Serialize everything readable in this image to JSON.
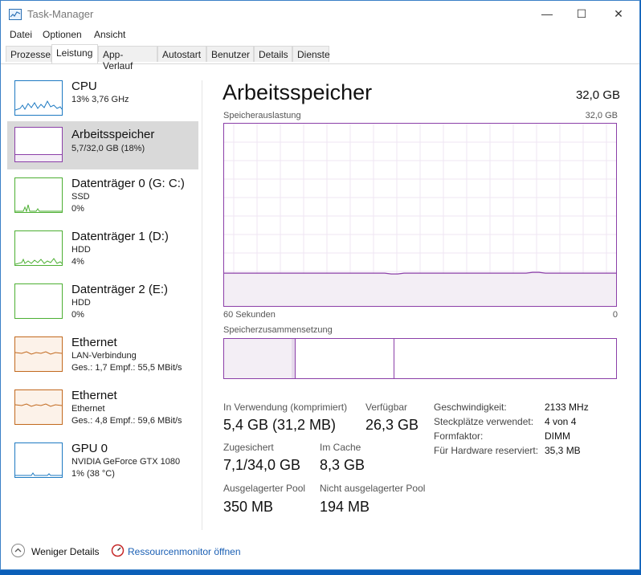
{
  "window": {
    "title": "Task-Manager",
    "minimize": "—",
    "maximize": "☐",
    "close": "✕"
  },
  "menu": [
    "Datei",
    "Optionen",
    "Ansicht"
  ],
  "tabs": [
    "Prozesse",
    "Leistung",
    "App-Verlauf",
    "Autostart",
    "Benutzer",
    "Details",
    "Dienste"
  ],
  "active_tab": "Leistung",
  "sidebar": [
    {
      "title": "CPU",
      "line1": "13% 3,76 GHz",
      "line2": "",
      "line3": "",
      "color": "#1e7ac2"
    },
    {
      "title": "Arbeitsspeicher",
      "line1": "5,7/32,0 GB (18%)",
      "line2": "",
      "line3": "",
      "color": "#8b3fa8"
    },
    {
      "title": "Datenträger 0 (G: C:)",
      "line1": "SSD",
      "line2": "0%",
      "line3": "",
      "color": "#4caf32"
    },
    {
      "title": "Datenträger 1 (D:)",
      "line1": "HDD",
      "line2": "4%",
      "line3": "",
      "color": "#4caf32"
    },
    {
      "title": "Datenträger 2 (E:)",
      "line1": "HDD",
      "line2": "0%",
      "line3": "",
      "color": "#4caf32"
    },
    {
      "title": "Ethernet",
      "line1": "LAN-Verbindung",
      "line2": "Ges.: 1,7 Empf.: 55,5 MBit/s",
      "line3": "",
      "color": "#c2691e"
    },
    {
      "title": "Ethernet",
      "line1": "Ethernet",
      "line2": "Ges.: 4,8 Empf.: 59,6 MBit/s",
      "line3": "",
      "color": "#c2691e"
    },
    {
      "title": "GPU 0",
      "line1": "NVIDIA GeForce GTX 1080",
      "line2": "1% (38 °C)",
      "line3": "",
      "color": "#1e7ac2"
    }
  ],
  "main": {
    "heading": "Arbeitsspeicher",
    "total": "32,0 GB",
    "usage_label": "Speicherauslastung",
    "usage_max": "32,0 GB",
    "time_left": "60 Sekunden",
    "time_right": "0",
    "composition_label": "Speicherzusammensetzung",
    "usage_fraction": 0.18,
    "stats": {
      "in_use_label": "In Verwendung (komprimiert)",
      "in_use_value": "5,4 GB (31,2 MB)",
      "available_label": "Verfügbar",
      "available_value": "26,3 GB",
      "committed_label": "Zugesichert",
      "committed_value": "7,1/34,0 GB",
      "cached_label": "Im Cache",
      "cached_value": "8,3 GB",
      "paged_label": "Ausgelagerter Pool",
      "paged_value": "350 MB",
      "nonpaged_label": "Nicht ausgelagerter Pool",
      "nonpaged_value": "194 MB"
    },
    "details": [
      {
        "label": "Geschwindigkeit:",
        "value": "2133 MHz"
      },
      {
        "label": "Steckplätze verwendet:",
        "value": "4 von 4"
      },
      {
        "label": "Formfaktor:",
        "value": "DIMM"
      },
      {
        "label": "Für Hardware reserviert:",
        "value": "35,3 MB"
      }
    ]
  },
  "footer": {
    "fewer_details": "Weniger Details",
    "resource_monitor": "Ressourcenmonitor öffnen"
  }
}
